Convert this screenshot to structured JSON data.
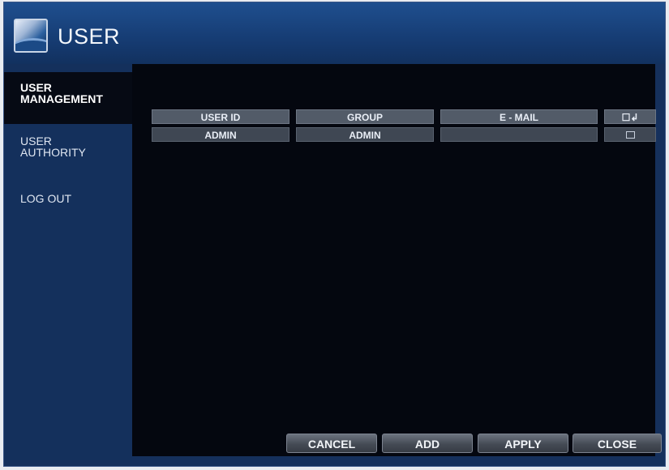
{
  "window": {
    "title": "USER"
  },
  "sidebar": {
    "items": [
      {
        "line1": "USER",
        "line2": "MANAGEMENT",
        "active": true
      },
      {
        "line1": "USER",
        "line2": "AUTHORITY",
        "active": false
      },
      {
        "line1": "LOG OUT",
        "line2": "",
        "active": false
      }
    ]
  },
  "table": {
    "headers": [
      "USER ID",
      "GROUP",
      "E - MAIL",
      "☐↲"
    ],
    "rows": [
      {
        "user_id": "ADMIN",
        "group": "ADMIN",
        "email": ""
      }
    ]
  },
  "buttons": {
    "cancel": "CANCEL",
    "add": "ADD",
    "apply": "APPLY",
    "close": "CLOSE"
  },
  "icons": {
    "app": "user-app-icon",
    "select_all": "checkbox-icon"
  },
  "colors": {
    "titlebar": "#1f4f8f",
    "sidebar": "#14305c",
    "content": "#04070f",
    "header_cell": "#525b68"
  }
}
